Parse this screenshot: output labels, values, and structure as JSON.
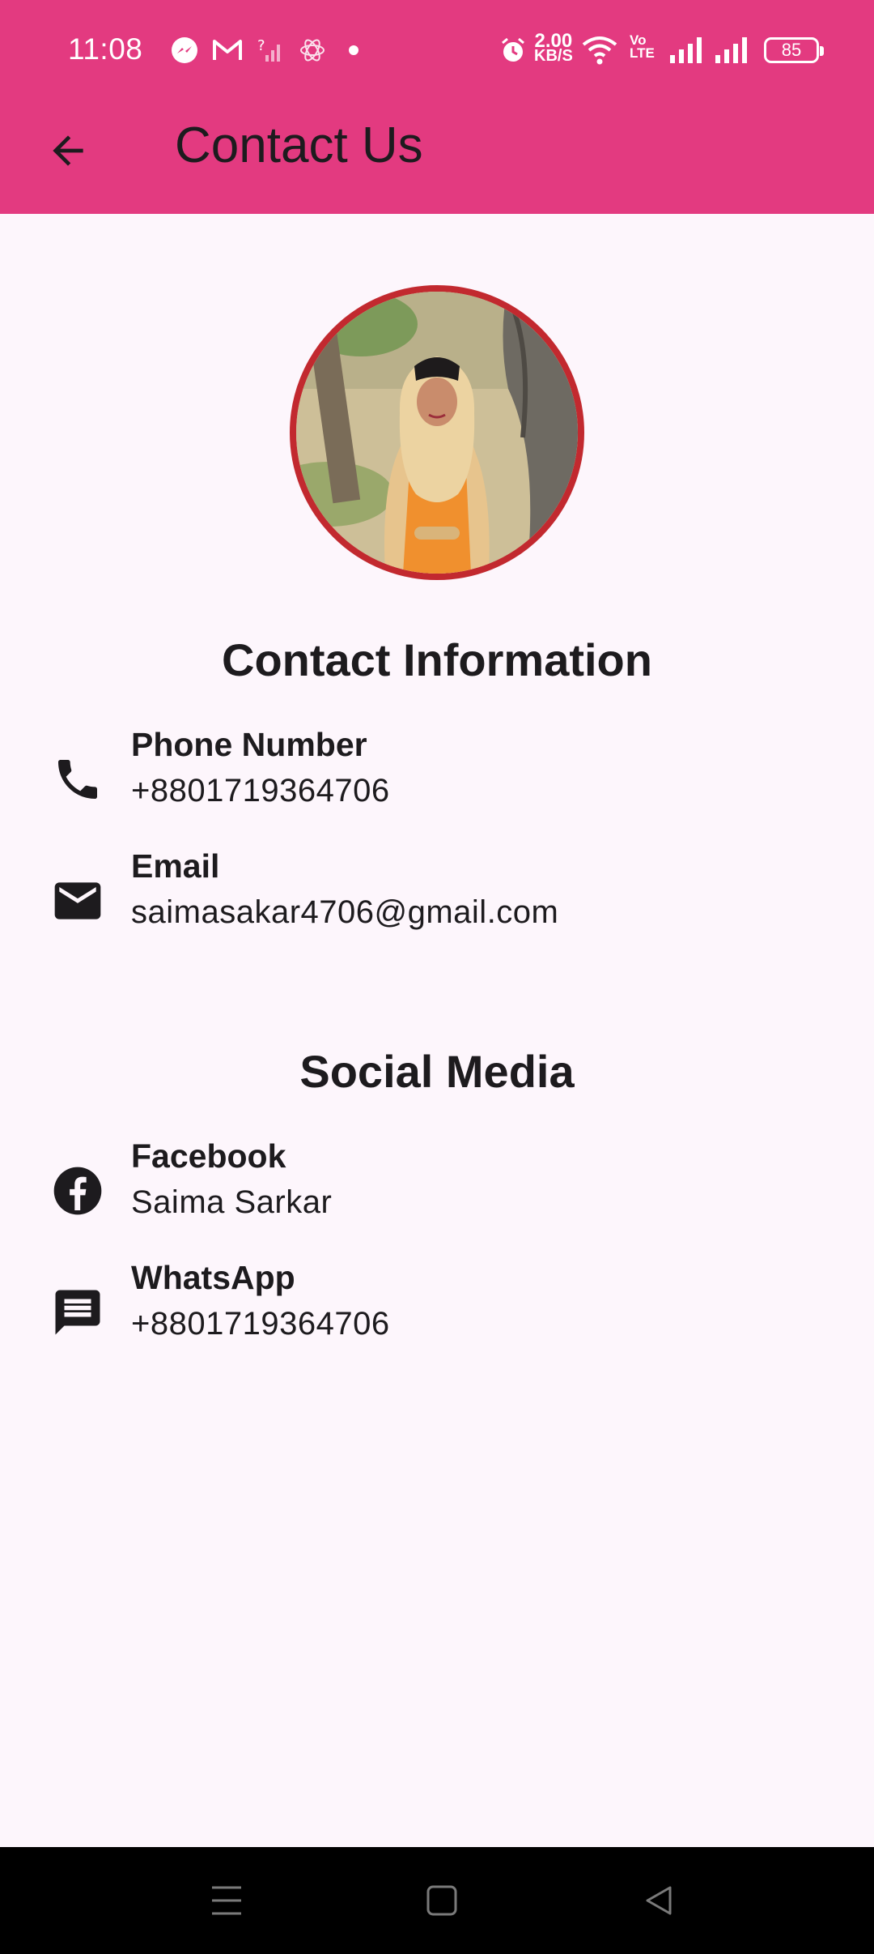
{
  "status_bar": {
    "time": "11:08",
    "net_speed_value": "2.00",
    "net_speed_unit": "KB/S",
    "battery": "85"
  },
  "app_bar": {
    "title": "Contact Us"
  },
  "colors": {
    "app_bar": "#e33a80",
    "background": "#fdf6fc",
    "avatar_border": "#c2292f",
    "text": "#1d1b1e"
  },
  "contact": {
    "heading": "Contact Information",
    "phone": {
      "label": "Phone Number",
      "value": "+8801719364706",
      "icon": "phone-icon"
    },
    "email": {
      "label": "Email",
      "value": "saimasakar4706@gmail.com",
      "icon": "mail-icon"
    }
  },
  "social": {
    "heading": "Social Media",
    "facebook": {
      "label": "Facebook",
      "value": "Saima Sarkar",
      "icon": "facebook-icon"
    },
    "whatsapp": {
      "label": "WhatsApp",
      "value": "+8801719364706",
      "icon": "chat-icon"
    }
  }
}
